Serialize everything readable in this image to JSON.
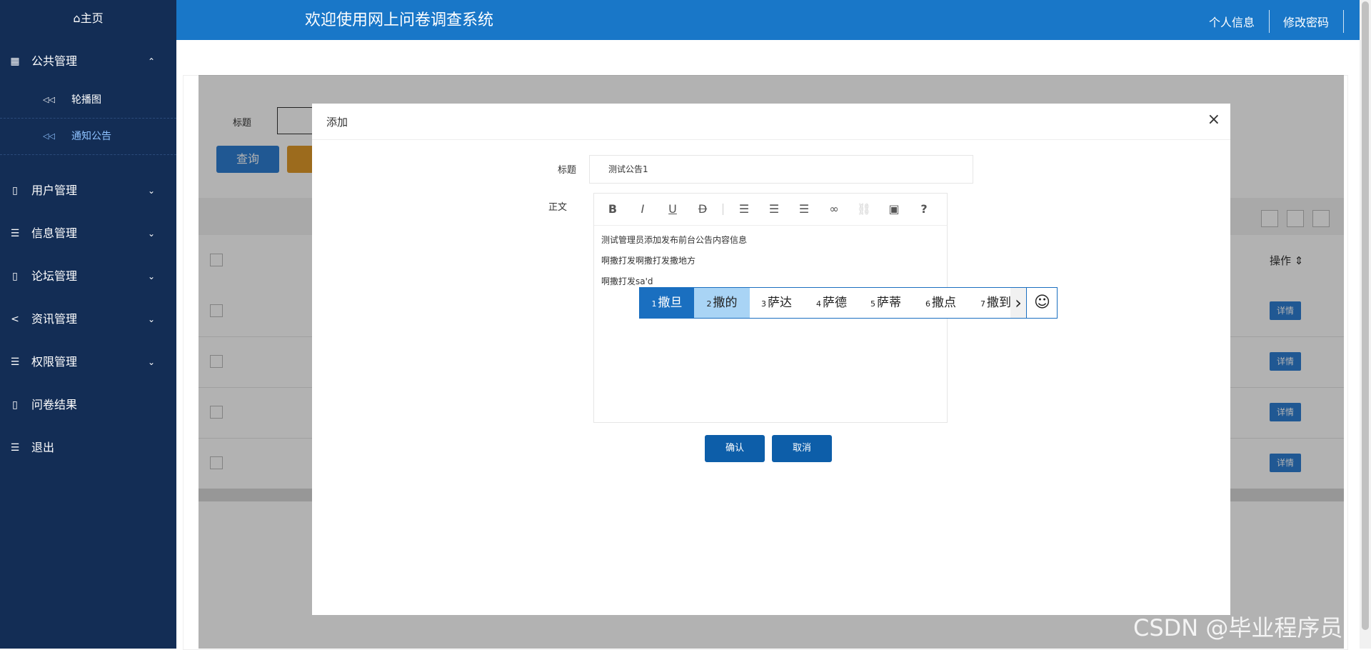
{
  "sidebar": {
    "home": "⌂主页",
    "items": [
      {
        "label": "公共管理",
        "chevron": "⌃",
        "icon": "grid-icon"
      },
      {
        "label": "用户管理",
        "chevron": "⌄",
        "icon": "book-icon"
      },
      {
        "label": "信息管理",
        "chevron": "⌄",
        "icon": "list-icon"
      },
      {
        "label": "论坛管理",
        "chevron": "⌄",
        "icon": "book-icon"
      },
      {
        "label": "资讯管理",
        "chevron": "⌄",
        "icon": "share-icon"
      },
      {
        "label": "权限管理",
        "chevron": "⌄",
        "icon": "list-icon"
      },
      {
        "label": "问卷结果",
        "chevron": "",
        "icon": "book-icon"
      },
      {
        "label": "退出",
        "chevron": "",
        "icon": "list-icon"
      }
    ],
    "subitems": [
      {
        "label": "轮播图"
      },
      {
        "label": "通知公告"
      }
    ]
  },
  "topbar": {
    "title": "欢迎使用网上问卷调查系统",
    "profile_link": "个人信息",
    "password_link": "修改密码"
  },
  "background": {
    "search_label": "标题",
    "query_button": "查询",
    "ops_header": "操作 ⇕",
    "detail_label": "详情"
  },
  "modal": {
    "title": "添加",
    "close": "×",
    "title_label": "标题",
    "title_value": "测试公告1",
    "body_label": "正文",
    "editor_lines": [
      "测试管理员添加发布前台公告内容信息",
      "啊撒打发啊撒打发撒地方",
      "啊撒打发sa'd"
    ],
    "confirm": "确认",
    "cancel": "取消"
  },
  "ime": {
    "candidates": [
      {
        "n": "1",
        "t": "撒旦"
      },
      {
        "n": "2",
        "t": "撒的"
      },
      {
        "n": "3",
        "t": "萨达"
      },
      {
        "n": "4",
        "t": "萨德"
      },
      {
        "n": "5",
        "t": "萨蒂"
      },
      {
        "n": "6",
        "t": "撒点"
      },
      {
        "n": "7",
        "t": "撒到"
      }
    ],
    "next": "›",
    "emoji": "☺"
  },
  "watermark": "CSDN @毕业程序员",
  "colors": {
    "sidebar": "#132d55",
    "topbar": "#1977c8",
    "accent": "#0d5ea9"
  }
}
